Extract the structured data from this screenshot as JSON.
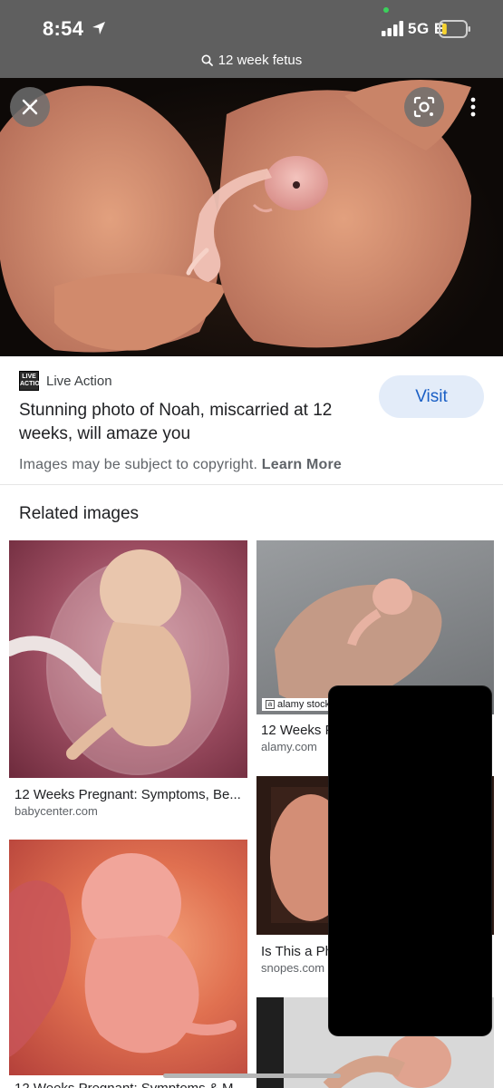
{
  "status_bar": {
    "time": "8:54",
    "network": "5G E",
    "battery_level": 0.2
  },
  "url_bar": {
    "query": "12 week fetus"
  },
  "hero": {
    "close_icon": "close-icon",
    "lens_icon": "lens-icon",
    "more_icon": "more-vert-icon"
  },
  "result": {
    "source_logo_text": "LIVE ACTION",
    "source_name": "Live Action",
    "title": "Stunning photo of Noah, miscarried at 12 weeks, will amaze you",
    "visit_label": "Visit",
    "copyright_text": "Images may be subject to copyright.",
    "learn_more_label": "Learn More"
  },
  "related": {
    "heading": "Related images",
    "tiles": [
      {
        "caption": "12 Weeks Pregnant: Symptoms, Be...",
        "domain": "babycenter.com"
      },
      {
        "caption": "12 Weeks F",
        "domain": "alamy.com",
        "badge": "alamy stock p"
      },
      {
        "caption": "Is This a Ph",
        "domain": "snopes.com"
      },
      {
        "caption": "12 Weeks Pregnant: Symptoms & M...",
        "domain": ""
      },
      {
        "caption": "",
        "domain": ""
      }
    ]
  },
  "colors": {
    "accent": "#1a5fc5",
    "visit_bg": "#e3ecf9",
    "topbar_bg": "#5f5f5f",
    "battery_fill": "#f7d32f"
  }
}
